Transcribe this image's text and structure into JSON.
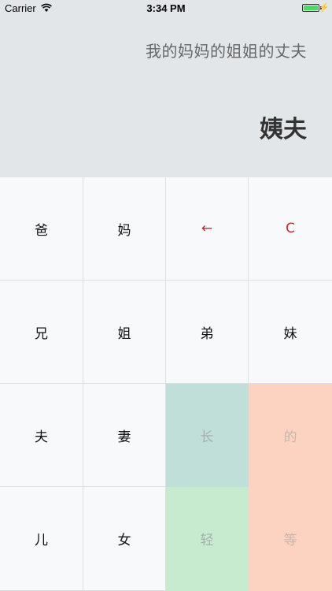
{
  "status_bar": {
    "carrier": "Carrier",
    "time": "3:34 PM",
    "charging_glyph": "⚡"
  },
  "display": {
    "expression": "我的妈妈的姐姐的丈夫",
    "result": "姨夫"
  },
  "keypad": {
    "rows": [
      [
        "爸",
        "妈",
        "←",
        "C"
      ],
      [
        "兄",
        "姐",
        "弟",
        "妹"
      ],
      [
        "夫",
        "妻",
        "长",
        "的"
      ],
      [
        "儿",
        "女",
        "轻",
        "等"
      ]
    ]
  },
  "colors": {
    "display_bg": "#e3e6e9",
    "accent_red": "#e01f26",
    "key_teal": "#c0dfd9",
    "key_mint": "#c7ebcf",
    "key_peach": "#fbd3c0"
  }
}
